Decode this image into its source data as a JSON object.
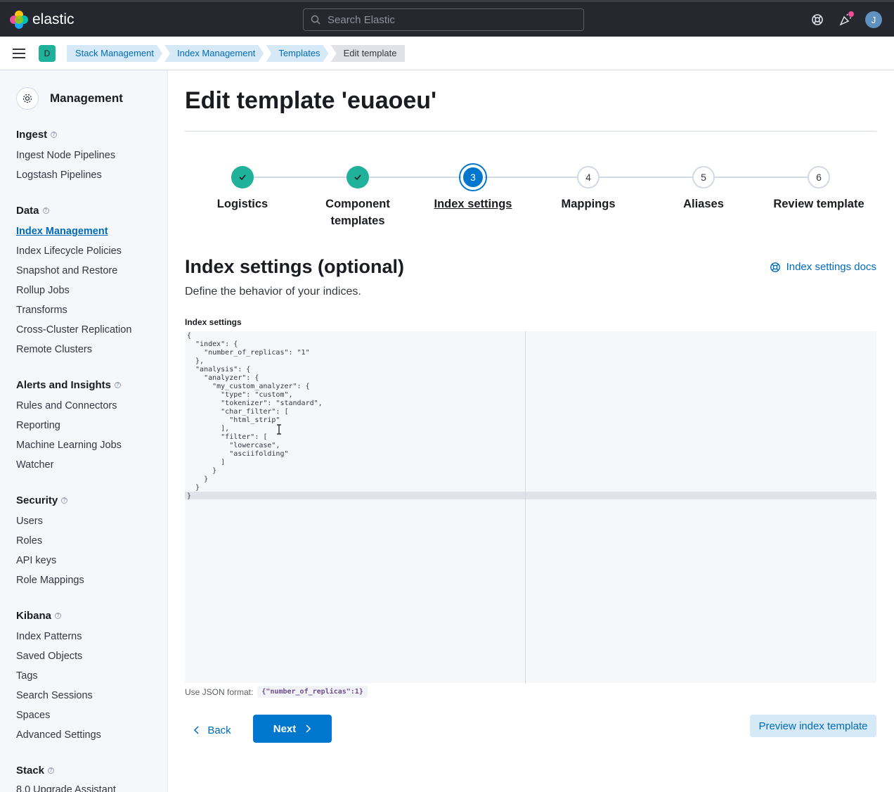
{
  "header": {
    "logo_text": "elastic",
    "search_placeholder": "Search Elastic",
    "avatar_initial": "J"
  },
  "breadcrumbs": {
    "space_initial": "D",
    "items": [
      "Stack Management",
      "Index Management",
      "Templates",
      "Edit template"
    ]
  },
  "sidebar": {
    "title": "Management",
    "groups": [
      {
        "title": "Ingest",
        "items": [
          "Ingest Node Pipelines",
          "Logstash Pipelines"
        ]
      },
      {
        "title": "Data",
        "items": [
          "Index Management",
          "Index Lifecycle Policies",
          "Snapshot and Restore",
          "Rollup Jobs",
          "Transforms",
          "Cross-Cluster Replication",
          "Remote Clusters"
        ]
      },
      {
        "title": "Alerts and Insights",
        "items": [
          "Rules and Connectors",
          "Reporting",
          "Machine Learning Jobs",
          "Watcher"
        ]
      },
      {
        "title": "Security",
        "items": [
          "Users",
          "Roles",
          "API keys",
          "Role Mappings"
        ]
      },
      {
        "title": "Kibana",
        "items": [
          "Index Patterns",
          "Saved Objects",
          "Tags",
          "Search Sessions",
          "Spaces",
          "Advanced Settings"
        ]
      },
      {
        "title": "Stack",
        "items": [
          "8.0 Upgrade Assistant"
        ]
      }
    ],
    "active_item": "Index Management"
  },
  "main": {
    "page_title": "Edit template 'euaoeu'",
    "steps": [
      {
        "number": "1",
        "label_line1": "Logistics",
        "label_line2": "",
        "state": "done"
      },
      {
        "number": "2",
        "label_line1": "Component",
        "label_line2": "templates",
        "state": "done"
      },
      {
        "number": "3",
        "label_line1": "Index settings",
        "label_line2": "",
        "state": "current"
      },
      {
        "number": "4",
        "label_line1": "Mappings",
        "label_line2": "",
        "state": "todo"
      },
      {
        "number": "5",
        "label_line1": "Aliases",
        "label_line2": "",
        "state": "todo"
      },
      {
        "number": "6",
        "label_line1": "Review template",
        "label_line2": "",
        "state": "todo"
      }
    ],
    "section_title": "Index settings (optional)",
    "docs_link": "Index settings docs",
    "section_description": "Define the behavior of your indices.",
    "field_label": "Index settings",
    "editor_value": "{\n  \"index\": {\n    \"number_of_replicas\": \"1\"\n  },\n  \"analysis\": {\n    \"analyzer\": {\n      \"my_custom_analyzer\": {\n        \"type\": \"custom\",\n        \"tokenizer\": \"standard\",\n        \"char_filter\": [\n          \"html_strip\"\n        ],\n        \"filter\": [\n          \"lowercase\",\n          \"asciifolding\"\n        ]\n      }\n    }\n  }\n}",
    "hint_label": "Use JSON format:",
    "hint_code": "{\"number_of_replicas\":1}",
    "back_label": "Back",
    "next_label": "Next",
    "preview_label": "Preview index template"
  },
  "colors": {
    "header_bg": "#25282f",
    "primary": "#0077cc",
    "success": "#20b19a",
    "link": "#006bb8"
  }
}
